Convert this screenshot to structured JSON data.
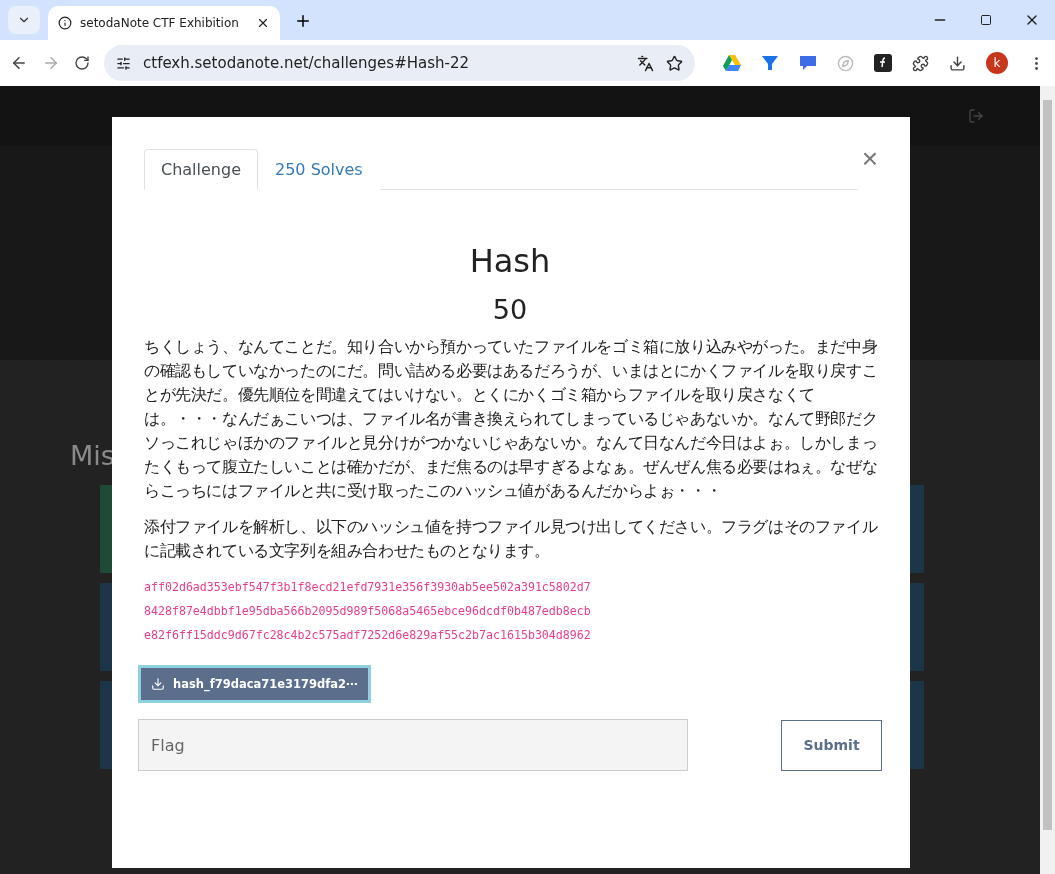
{
  "browser": {
    "tab_title": "setodaNote CTF Exhibition",
    "url": "ctfexh.setodanote.net/challenges#Hash-22",
    "profile_initial": "k"
  },
  "sections": [
    "Mis"
  ],
  "modal": {
    "tabs": [
      {
        "label": "Challenge",
        "selected": true
      },
      {
        "label": "250 Solves",
        "selected": false
      }
    ],
    "close": "×",
    "title": "Hash",
    "value": "50",
    "paragraphs": [
      "ちくしょう、なんてことだ。知り合いから預かっていたファイルをゴミ箱に放り込みやがった。まだ中身の確認もしていなかったのにだ。問い詰める必要はあるだろうが、いまはとにかくファイルを取り戻すことが先決だ。優先順位を間違えてはいけない。とくにかくゴミ箱からファイルを取り戻さなくては。・・・なんだぁこいつは、ファイル名が書き換えられてしまっているじゃあないか。なんて野郎だクソっこれじゃほかのファイルと見分けがつかないじゃあないか。なんて日なんだ今日はよぉ。しかしまったくもって腹立たしいことは確かだが、まだ焦るのは早すぎるよなぁ。ぜんぜん焦る必要はねぇ。なぜならこっちにはファイルと共に受け取ったこのハッシュ値があるんだからよぉ・・・",
      "添付ファイルを解析し、以下のハッシュ値を持つファイル見つけ出してください。フラグはそのファイルに記載されている文字列を組み合わせたものとなります。"
    ],
    "hashes": [
      "aff02d6ad353ebf547f3b1f8ecd21efd7931e356f3930ab5ee502a391c5802d7",
      "8428f87e4dbbf1e95dba566b2095d989f5068a5465ebce96dcdf0b487edb8ecb",
      "e82f6ff15ddc9d67fc28c4b2c575adf7252d6e829af55c2b7ac1615b304d8962"
    ],
    "file": "hash_f79daca71e3179dfa2⋯",
    "flag": {
      "placeholder": "Flag"
    },
    "submit": "Submit"
  }
}
